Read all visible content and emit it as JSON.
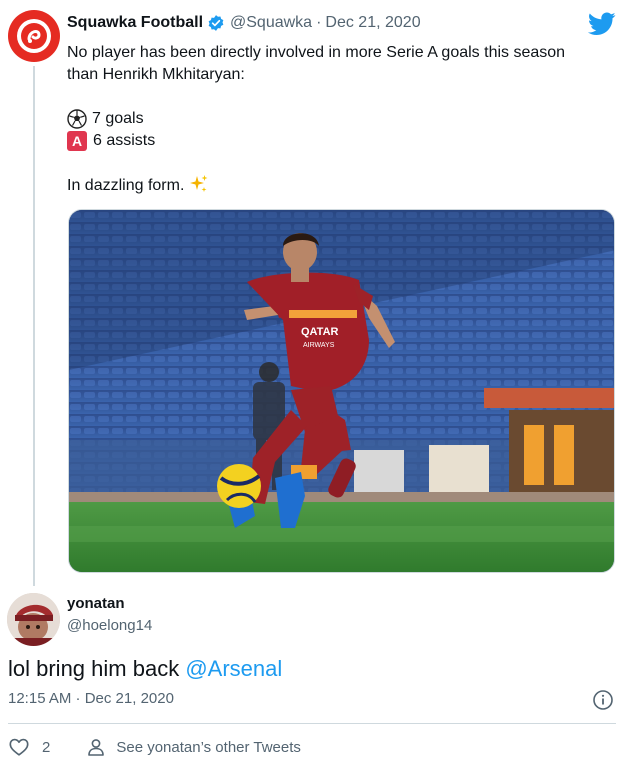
{
  "quoted_tweet": {
    "author_name": "Squawka Football",
    "author_handle": "@Squawka",
    "separator": "·",
    "date": "Dec 21, 2020",
    "text_line1": "No player has been directly involved in more Serie A goals this season",
    "text_line2": "than Henrikh Mkhitaryan:",
    "stat_goals": "7 goals",
    "stat_assists": "6 assists",
    "assist_badge_letter": "A",
    "closing_text": "In dazzling form.",
    "jersey_sponsor_line1": "QATAR",
    "jersey_sponsor_line2": "AIRWAYS",
    "icons": {
      "avatar": "squawka-logo-icon",
      "verified": "verified-badge-icon",
      "platform": "twitter-bird-icon",
      "goals": "soccer-ball-icon",
      "assists": "letter-a-icon",
      "sparkles": "sparkles-icon"
    }
  },
  "reply_tweet": {
    "author_name": "yonatan",
    "author_handle": "@hoelong14",
    "text": "lol bring him back ",
    "mention": "@Arsenal",
    "timestamp": "12:15 AM · Dec 21, 2020",
    "like_count": "2",
    "see_other_label": "See yonatan’s other Tweets",
    "icons": {
      "info": "info-icon",
      "like": "heart-icon",
      "profile": "person-icon"
    }
  },
  "colors": {
    "squawka_red": "#e52b22",
    "twitter_blue": "#1d9bf0",
    "secondary_text": "#536471",
    "divider": "#cfd9de",
    "assist_badge": "#e0364f"
  }
}
